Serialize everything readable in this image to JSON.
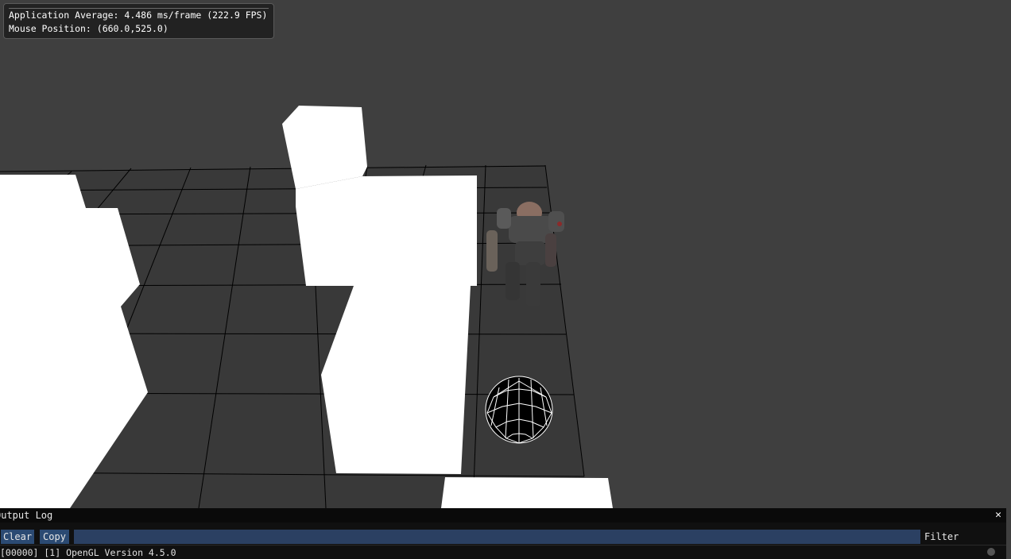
{
  "overlay": {
    "fps_line": "Application Average: 4.486 ms/frame (222.9 FPS)",
    "mouse_line": "Mouse Position: (660.0,525.0)"
  },
  "output_log": {
    "title": "Output Log",
    "close_icon": "close-icon",
    "clear_label": "Clear",
    "copy_label": "Copy",
    "filter_value": "",
    "filter_label": "Filter",
    "entries": [
      "[00000] [1] OpenGL Version 4.5.0"
    ]
  },
  "scene": {
    "background_color": "#3f3f3f",
    "floor_color": "#393939",
    "grid_line_color": "#000000",
    "block_color": "#ffffff",
    "objects": [
      "floor-grid",
      "white-blocks",
      "robot-character",
      "wireframe-sphere"
    ]
  },
  "colors": {
    "button_bg": "#2b4a73",
    "input_bg": "#2b4062",
    "log_bg": "#0f0f0f"
  }
}
